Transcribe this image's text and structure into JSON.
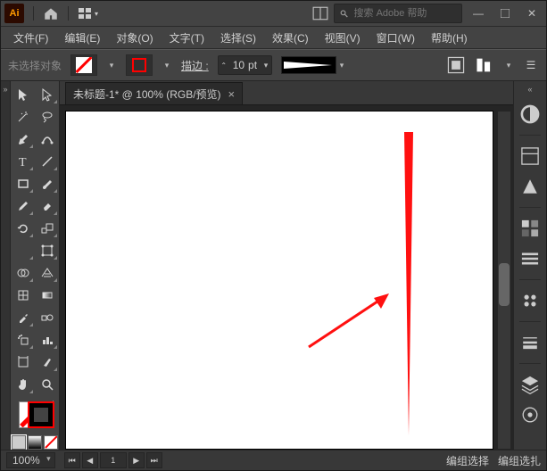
{
  "app_badge": "Ai",
  "search_placeholder": "搜索 Adobe 帮助",
  "menu": [
    "文件(F)",
    "编辑(E)",
    "对象(O)",
    "文字(T)",
    "选择(S)",
    "效果(C)",
    "视图(V)",
    "窗口(W)",
    "帮助(H)"
  ],
  "ctrl": {
    "no_selection": "未选择对象",
    "stroke_label": "描边 :",
    "stroke_value": "10",
    "stroke_unit": "pt"
  },
  "doc_tab": "未标题-1* @ 100% (RGB/预览)",
  "status": {
    "zoom": "100%",
    "page": "1",
    "mode": "编组选择",
    "tool": "编组选扎"
  }
}
